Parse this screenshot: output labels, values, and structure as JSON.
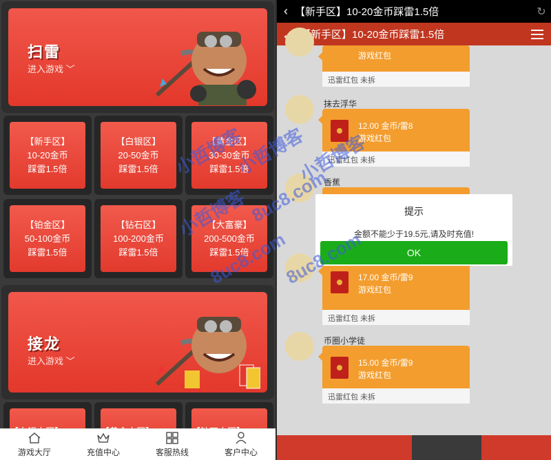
{
  "left": {
    "banners": [
      {
        "title": "扫雷",
        "subtitle": "进入游戏 ﹀"
      },
      {
        "title": "接龙",
        "subtitle": "进入游戏 ﹀"
      }
    ],
    "tiles": [
      {
        "zone": "【新手区】",
        "range": "10-20金币",
        "mult": "踩雷1.5倍"
      },
      {
        "zone": "【白银区】",
        "range": "20-50金币",
        "mult": "踩雷1.5倍"
      },
      {
        "zone": "【黄金区】",
        "range": "30-30金币",
        "mult": "踩雷1.5倍"
      },
      {
        "zone": "【铂金区】",
        "range": "50-100金币",
        "mult": "踩雷1.5倍"
      },
      {
        "zone": "【钻石区】",
        "range": "100-200金币",
        "mult": "踩雷1.5倍"
      },
      {
        "zone": "【大富豪】",
        "range": "200-500金币",
        "mult": "踩雷1.5倍"
      }
    ],
    "bottom_tiles": [
      "【白银大厅】",
      "【黄金大厅】",
      "【钻石大厅】"
    ],
    "tabbar": [
      {
        "label": "游戏大厅",
        "icon": "home-icon"
      },
      {
        "label": "充值中心",
        "icon": "crown-icon"
      },
      {
        "label": "客服热线",
        "icon": "grid-icon"
      },
      {
        "label": "客户中心",
        "icon": "user-icon"
      }
    ]
  },
  "right": {
    "status_title": "【新手区】10-20金币踩雷1.5倍",
    "nav_title": "【新手区】10-20金币踩雷1.5倍",
    "messages": [
      {
        "user": "",
        "amount": "",
        "game": "游戏红包",
        "footer": "迅雷红包 未拆"
      },
      {
        "user": "抹去浮华",
        "amount": "12.00 金币/雷8",
        "game": "游戏红包",
        "footer": "迅雷红包 未拆"
      },
      {
        "user": "香蕉",
        "amount": "",
        "game": "",
        "footer": ""
      },
      {
        "user": "",
        "amount": "17.00 金币/雷9",
        "game": "游戏红包",
        "footer": "迅雷红包 未拆"
      },
      {
        "user": "币圈小学徒",
        "amount": "15.00 金币/雷9",
        "game": "游戏红包",
        "footer": "迅雷红包 未拆"
      }
    ],
    "dialog": {
      "title": "提示",
      "message": "金额不能少于19.5元,请及时充值!",
      "ok": "OK"
    }
  },
  "watermark": [
    "小哲博客",
    "小哲博客",
    "小哲博客",
    "小哲博客",
    "8uc8.com",
    "8uc8.com",
    "8uc8.com"
  ],
  "colors": {
    "banner_red": "#e3382b",
    "nav_red": "#c1361f",
    "bubble_orange": "#f39d2e",
    "ok_green": "#1aad19"
  }
}
